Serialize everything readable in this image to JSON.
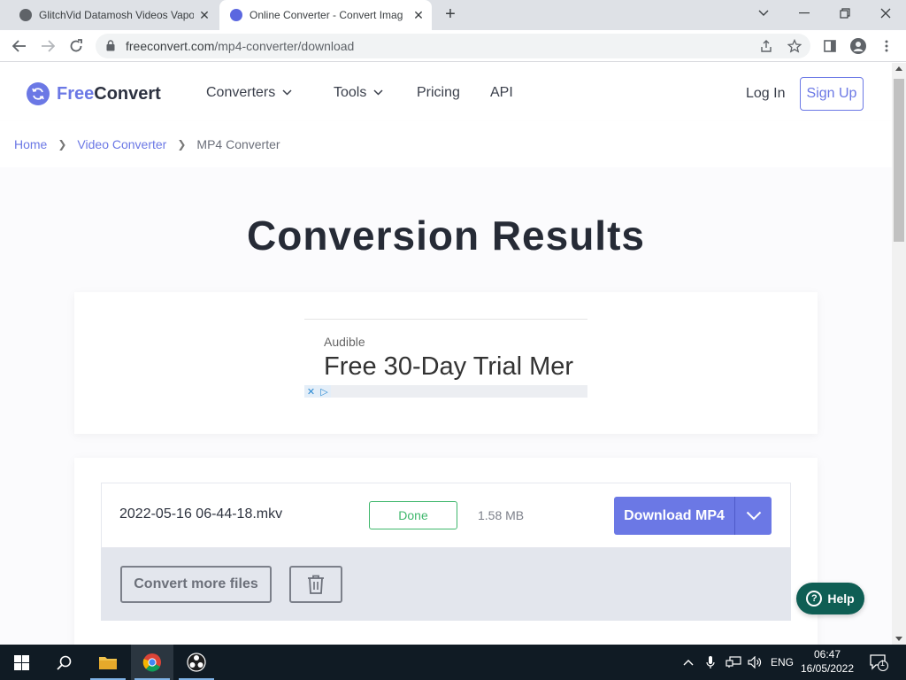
{
  "browser": {
    "tabs": [
      {
        "title": "GlitchVid Datamosh Videos Vapo",
        "active": false
      },
      {
        "title": "Online Converter - Convert Imag",
        "active": true
      }
    ],
    "url_host": "freeconvert.com",
    "url_path": "/mp4-converter/download"
  },
  "header": {
    "logo_free": "Free",
    "logo_convert": "Convert",
    "nav": [
      "Converters",
      "Tools",
      "Pricing",
      "API"
    ],
    "login": "Log In",
    "signup": "Sign Up"
  },
  "breadcrumb": [
    "Home",
    "Video Converter",
    "MP4 Converter"
  ],
  "main": {
    "title": "Conversion Results",
    "ad": {
      "brand": "Audible",
      "headline": "Free 30-Day Trial Mer"
    },
    "file": {
      "name": "2022-05-16 06-44-18.mkv",
      "status": "Done",
      "size": "1.58 MB",
      "download_label": "Download MP4"
    },
    "convert_more_label": "Convert more files",
    "help_label": "Help"
  },
  "taskbar": {
    "lang": "ENG",
    "time": "06:47",
    "date": "16/05/2022",
    "notifications": "1"
  },
  "colors": {
    "brand": "#6b78e5",
    "done": "#3fb76c",
    "help": "#0f5e54"
  }
}
